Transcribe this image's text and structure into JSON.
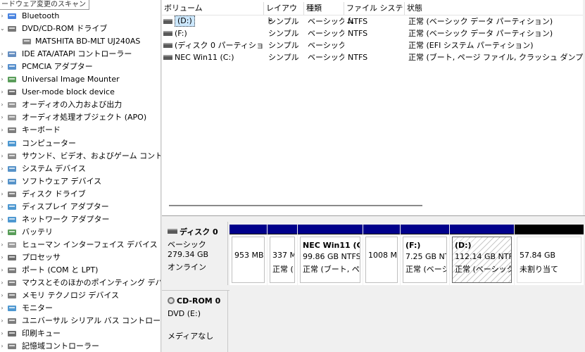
{
  "tooltip": "ードウェア変更のスキャン",
  "tree": [
    {
      "label": "Bluetooth",
      "icon": "bluetooth-icon",
      "level": 1
    },
    {
      "label": "DVD/CD-ROM ドライブ",
      "icon": "dvd-drive-icon",
      "level": 1,
      "expanded": true
    },
    {
      "label": "MATSHITA BD-MLT UJ240AS",
      "icon": "disc-drive-icon",
      "level": 2
    },
    {
      "label": "IDE ATA/ATAPI コントローラー",
      "icon": "ide-controller-icon",
      "level": 1
    },
    {
      "label": "PCMCIA アダプター",
      "icon": "pcmcia-icon",
      "level": 1
    },
    {
      "label": "Universal Image Mounter",
      "icon": "image-mounter-icon",
      "level": 1
    },
    {
      "label": "User-mode block device",
      "icon": "block-device-icon",
      "level": 1
    },
    {
      "label": "オーディオの入力および出力",
      "icon": "audio-io-icon",
      "level": 1
    },
    {
      "label": "オーディオ処理オブジェクト (APO)",
      "icon": "audio-apo-icon",
      "level": 1
    },
    {
      "label": "キーボード",
      "icon": "keyboard-icon",
      "level": 1
    },
    {
      "label": "コンピューター",
      "icon": "computer-icon",
      "level": 1
    },
    {
      "label": "サウンド、ビデオ、およびゲーム コントローラー",
      "icon": "sound-icon",
      "level": 1
    },
    {
      "label": "システム デバイス",
      "icon": "system-device-icon",
      "level": 1
    },
    {
      "label": "ソフトウェア デバイス",
      "icon": "software-device-icon",
      "level": 1
    },
    {
      "label": "ディスク ドライブ",
      "icon": "disk-drive-icon",
      "level": 1
    },
    {
      "label": "ディスプレイ アダプター",
      "icon": "display-adapter-icon",
      "level": 1
    },
    {
      "label": "ネットワーク アダプター",
      "icon": "network-adapter-icon",
      "level": 1
    },
    {
      "label": "バッテリ",
      "icon": "battery-icon",
      "level": 1
    },
    {
      "label": "ヒューマン インターフェイス デバイス",
      "icon": "hid-icon",
      "level": 1
    },
    {
      "label": "プロセッサ",
      "icon": "processor-icon",
      "level": 1
    },
    {
      "label": "ポート (COM と LPT)",
      "icon": "port-icon",
      "level": 1
    },
    {
      "label": "マウスとそのほかのポインティング デバイス",
      "icon": "mouse-icon",
      "level": 1
    },
    {
      "label": "メモリ テクノロジ デバイス",
      "icon": "memory-icon",
      "level": 1
    },
    {
      "label": "モニター",
      "icon": "monitor-icon",
      "level": 1
    },
    {
      "label": "ユニバーサル シリアル バス コントローラー",
      "icon": "usb-icon",
      "level": 1
    },
    {
      "label": "印刷キュー",
      "icon": "print-queue-icon",
      "level": 1
    },
    {
      "label": "記憶域コントローラー",
      "icon": "storage-controller-icon",
      "level": 1
    }
  ],
  "volumes": {
    "headers": [
      "ボリューム",
      "レイアウト",
      "種類",
      "ファイル システム",
      "状態"
    ],
    "rows": [
      {
        "name": "(D:)",
        "layout": "シンプル",
        "type": "ベーシック",
        "fs": "NTFS",
        "status": "正常 (ベーシック データ パーティション)",
        "selected": true
      },
      {
        "name": "(F:)",
        "layout": "シンプル",
        "type": "ベーシック",
        "fs": "NTFS",
        "status": "正常 (ベーシック データ パーティション)"
      },
      {
        "name": "(ディスク 0 パーティション 2)",
        "layout": "シンプル",
        "type": "ベーシック",
        "fs": "",
        "status": "正常 (EFI システム パーティション)"
      },
      {
        "name": "NEC Win11 (C:)",
        "layout": "シンプル",
        "type": "ベーシック",
        "fs": "NTFS",
        "status": "正常 (ブート, ページ ファイル, クラッシュ ダンプ, ベーシ"
      }
    ]
  },
  "disk0": {
    "title": "ディスク 0",
    "type": "ベーシック",
    "size": "279.34 GB",
    "state": "オンライン",
    "partitions": [
      {
        "line1": "",
        "line2": "953 MB",
        "line3": ""
      },
      {
        "line1": "",
        "line2": "337 M",
        "line3": "正常 ("
      },
      {
        "line1": "NEC Win11  (C",
        "line2": "99.86 GB NTFS",
        "line3": "正常 (ブート, ペ"
      },
      {
        "line1": "",
        "line2": "1008 M",
        "line3": ""
      },
      {
        "line1": "(F:)",
        "line2": "7.25 GB NT",
        "line3": "正常 (ベーシ"
      },
      {
        "line1": "(D:)",
        "line2": "112.14 GB NTF",
        "line3": "正常 (ベーシック"
      },
      {
        "line1": "",
        "line2": "57.84 GB",
        "line3": "未割り当て"
      }
    ]
  },
  "cdrom0": {
    "title": "CD-ROM 0",
    "drive": "DVD (E:)",
    "media": "メディアなし"
  },
  "colors": {
    "partition_bar": "#00008b",
    "unallocated_bar": "#000000",
    "selection": "#cce8ff"
  }
}
